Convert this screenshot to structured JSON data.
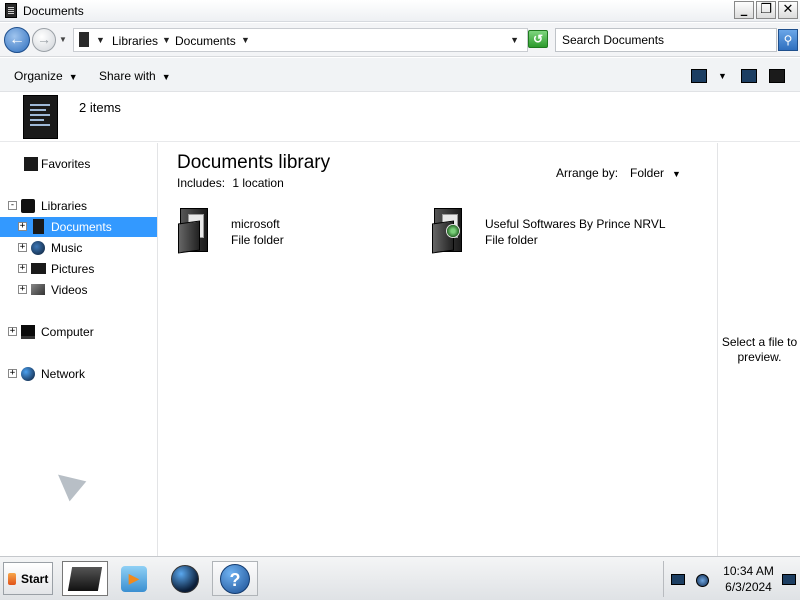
{
  "window": {
    "title": "Documents",
    "controls": {
      "minimize": "_",
      "restore": "❐",
      "close": "✕"
    }
  },
  "address": {
    "crumbs": [
      "Libraries",
      "Documents"
    ],
    "search_placeholder": "Search Documents"
  },
  "toolbar": {
    "organize_label": "Organize",
    "share_label": "Share with"
  },
  "details": {
    "items_count": "2 items"
  },
  "nav": {
    "favorites": "Favorites",
    "libraries": "Libraries",
    "documents": "Documents",
    "music": "Music",
    "pictures": "Pictures",
    "videos": "Videos",
    "computer": "Computer",
    "network": "Network"
  },
  "content": {
    "title": "Documents library",
    "includes_label": "Includes:",
    "includes_link": "1 location",
    "arrange_label": "Arrange by:",
    "arrange_value": "Folder",
    "files": [
      {
        "name": "microsoft",
        "type": "File folder"
      },
      {
        "name": "Useful Softwares By Prince NRVL",
        "type": "File folder"
      }
    ]
  },
  "preview": {
    "text": "Select a file to preview."
  },
  "taskbar": {
    "start_label": "Start",
    "time": "10:34 AM",
    "date": "6/3/2024"
  },
  "colors": {
    "selection": "#3399ff",
    "nav_bg": "#ffffff",
    "toolbar_bg": "#f1f3f5"
  }
}
